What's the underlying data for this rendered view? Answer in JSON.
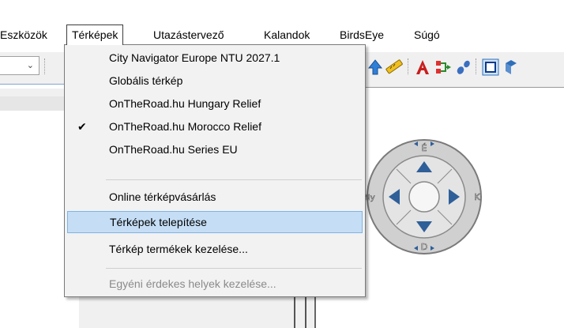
{
  "menubar": {
    "items": [
      {
        "label": "Eszközök"
      },
      {
        "label": "Térképek"
      },
      {
        "label": "Utazástervező"
      },
      {
        "label": "Kalandok"
      },
      {
        "label": "BirdsEye"
      },
      {
        "label": "Súgó"
      }
    ]
  },
  "maps_menu": {
    "items": [
      {
        "label": "City Navigator Europe NTU 2027.1"
      },
      {
        "label": "Globális térkép"
      },
      {
        "label": "OnTheRoad.hu Hungary Relief"
      },
      {
        "label": "OnTheRoad.hu Morocco Relief",
        "checked": true
      },
      {
        "label": "OnTheRoad.hu Series EU"
      },
      {
        "label": "Online térképvásárlás"
      },
      {
        "label": "Térképek telepítése",
        "highlighted": true
      },
      {
        "label": "Térkép termékek kezelése..."
      },
      {
        "label": "Egyéni érdekes helyek kezelése...",
        "disabled": true
      }
    ],
    "check_glyph": "✔"
  },
  "navpad": {
    "north": "É",
    "south": "D",
    "west": "Ny",
    "east": "K"
  },
  "toolbar": {
    "icons": [
      "route-arrow-icon",
      "ruler-icon",
      "text-tool-icon",
      "route-tool-icon",
      "tracks-icon",
      "frame-tool-icon",
      "globe-icon"
    ]
  },
  "colors": {
    "highlight": "#c5def5",
    "menu_background": "#f2f2f2",
    "window_background": "#f0f0f0"
  }
}
